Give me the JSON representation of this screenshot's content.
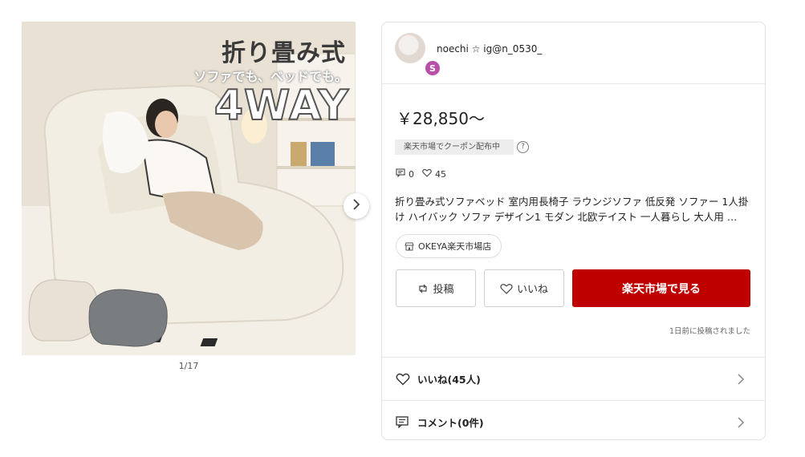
{
  "image": {
    "title_overlay": "折り畳み式",
    "subtitle_overlay": "ソファでも、ベッドでも。",
    "badge_overlay": "4WAY",
    "counter": "1/17",
    "next_icon": "chevron-right-icon"
  },
  "user": {
    "avatar_badge": "S",
    "name": "noechi ☆ ig@n_0530_"
  },
  "product": {
    "price": "￥28,850～",
    "coupon": "楽天市場でクーポン配布中",
    "help": "?",
    "comment_count": "0",
    "like_count": "45",
    "description": "折り畳み式ソファベッド 室内用長椅子 ラウンジソファ 低反発 ソファー 1人掛け ハイバック ソファ デザイン1 モダン 北欧テイスト 一人暮らし 大人用 …",
    "shop": "OKEYA楽天市場店"
  },
  "actions": {
    "post": "投稿",
    "like": "いいね",
    "view": "楽天市場で見る"
  },
  "posted_time": "1日前に投稿されました",
  "rows": {
    "likes": "いいね(45人)",
    "comments": "コメント(0件)"
  },
  "colors": {
    "accent_red": "#bf0000",
    "avatar_badge": "#b84fa9"
  }
}
